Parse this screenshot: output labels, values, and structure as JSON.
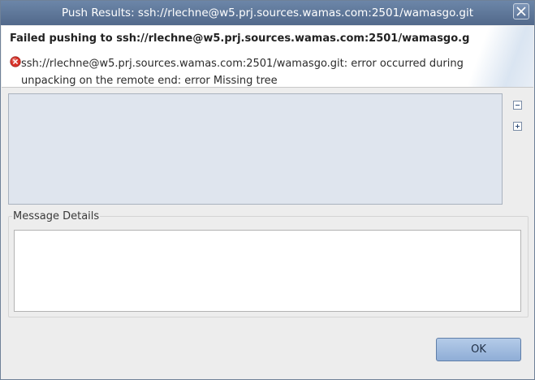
{
  "window": {
    "title": "Push Results: ssh://rlechne@w5.prj.sources.wamas.com:2501/wamasgo.git"
  },
  "header": {
    "title": "Failed pushing to ssh://rlechne@w5.prj.sources.wamas.com:2501/wamasgo.g",
    "message": "ssh://rlechne@w5.prj.sources.wamas.com:2501/wamasgo.git: error occurred during unpacking on the remote end: error Missing tree",
    "message_icon": "error-icon"
  },
  "results_tree": {
    "toolbar": [
      {
        "name": "collapse-all",
        "icon": "collapse-icon"
      },
      {
        "name": "expand-all",
        "icon": "expand-icon"
      }
    ]
  },
  "details": {
    "label": "Message Details",
    "value": ""
  },
  "buttons": {
    "ok": "OK"
  },
  "colors": {
    "titlebar": "#5f789b",
    "tree_background": "#dfe5ee",
    "error": "#d9342b",
    "button": "#a2bde0"
  }
}
